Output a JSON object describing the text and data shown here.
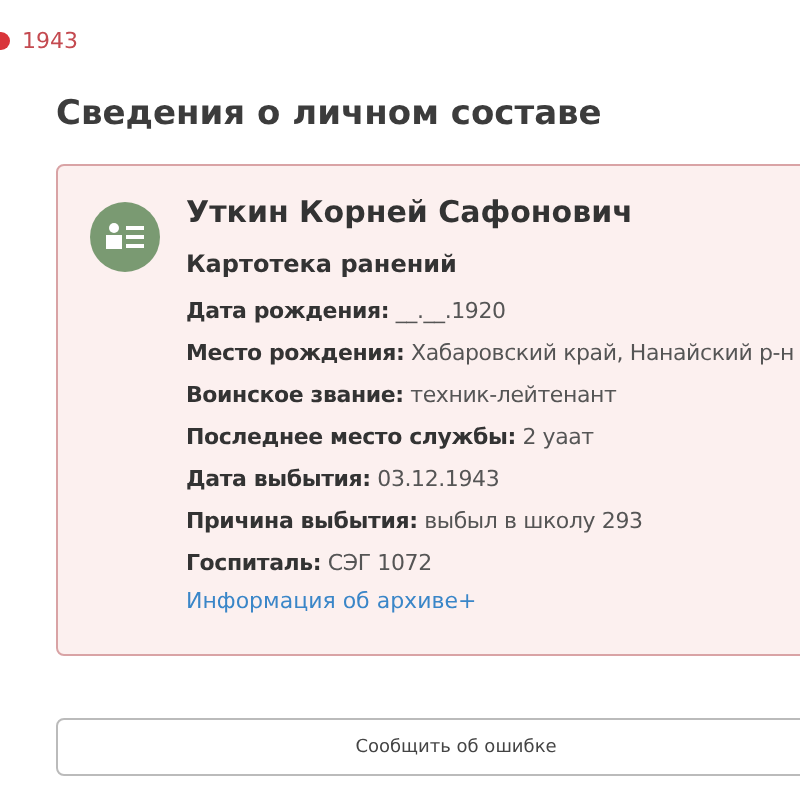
{
  "year_marker": {
    "label": "1943",
    "color": "#d9343a"
  },
  "section_title": "Сведения о личном составе",
  "record": {
    "name": "Уткин Корней Сафонович",
    "source": "Картотека ранений",
    "fields": [
      {
        "label": "Дата рождения:",
        "value": "__.__.1920"
      },
      {
        "label": "Место рождения:",
        "value": "Хабаровский край, Нанайский р-н"
      },
      {
        "label": "Воинское звание:",
        "value": "техник-лейтенант"
      },
      {
        "label": "Последнее место службы:",
        "value": "2 уаат"
      },
      {
        "label": "Дата выбытия:",
        "value": "03.12.1943"
      },
      {
        "label": "Причина выбытия:",
        "value": "выбыл в школу 293"
      },
      {
        "label": "Госпиталь:",
        "value": "СЭГ 1072"
      }
    ],
    "archive_link": "Информация об архиве+"
  },
  "report_button": "Сообщить об ошибке"
}
